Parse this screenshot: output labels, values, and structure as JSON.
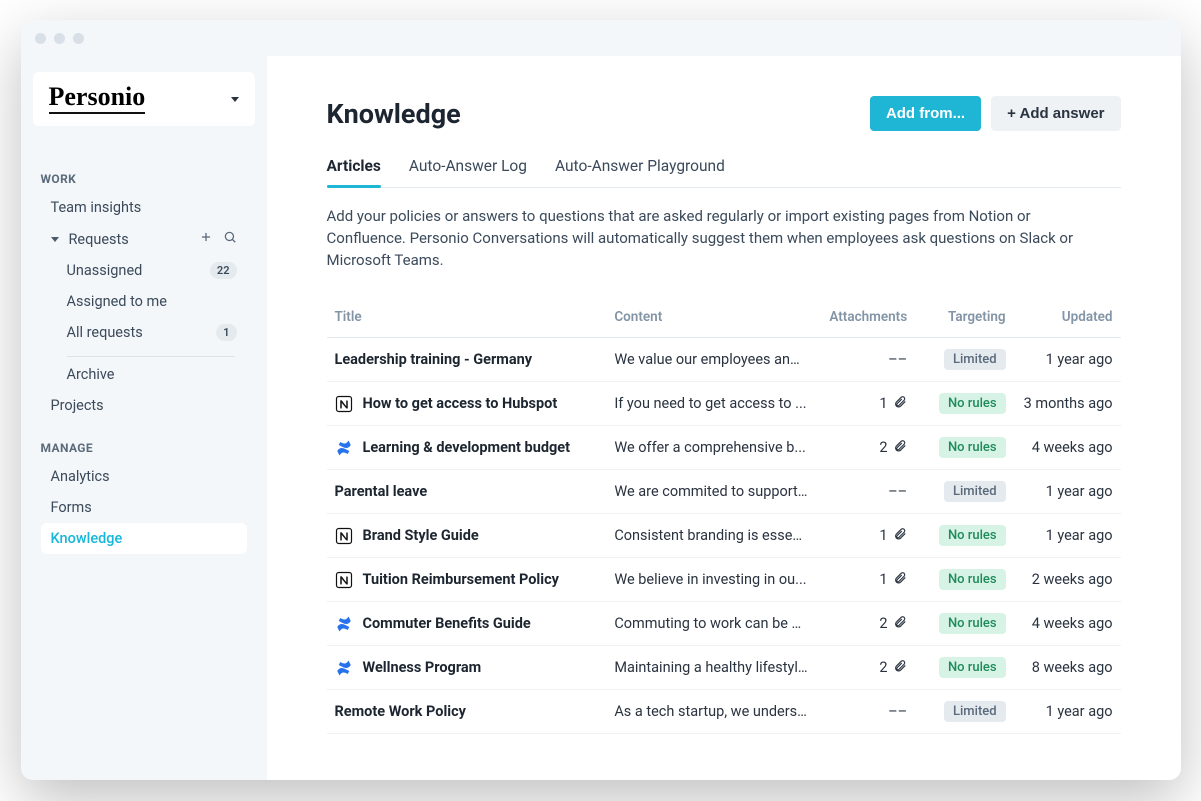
{
  "brand": "Personio",
  "sidebar": {
    "sections": [
      {
        "heading": "WORK",
        "items": [
          {
            "label": "Team insights"
          },
          {
            "label": "Requests",
            "expandable": true,
            "expanded": true,
            "children": [
              {
                "label": "Unassigned",
                "badge": "22"
              },
              {
                "label": "Assigned to me"
              },
              {
                "label": "All requests",
                "badge": "1"
              },
              {
                "divider": true
              },
              {
                "label": "Archive"
              }
            ]
          },
          {
            "label": "Projects"
          }
        ]
      },
      {
        "heading": "MANAGE",
        "items": [
          {
            "label": "Analytics"
          },
          {
            "label": "Forms"
          },
          {
            "label": "Knowledge",
            "active": true
          }
        ]
      }
    ]
  },
  "page": {
    "title": "Knowledge",
    "actions": {
      "add_from": "Add from...",
      "add_answer": "+ Add answer"
    },
    "tabs": [
      {
        "label": "Articles",
        "active": true
      },
      {
        "label": "Auto-Answer Log"
      },
      {
        "label": "Auto-Answer Playground"
      }
    ],
    "description": "Add your policies or answers to questions that are asked regularly or import existing pages from Notion or Confluence. Personio Conversations will automatically suggest them when employees ask questions on Slack or Microsoft Teams."
  },
  "table": {
    "columns": {
      "title": "Title",
      "content": "Content",
      "attachments": "Attachments",
      "targeting": "Targeting",
      "updated": "Updated"
    },
    "rows": [
      {
        "source": "none",
        "title": "Leadership training - Germany",
        "content": "We value our employees and...",
        "attachments": "––",
        "targeting": "Limited",
        "updated": "1 year ago"
      },
      {
        "source": "notion",
        "title": "How to get access to Hubspot",
        "content": "If you need to get access to ...",
        "attachments": "1",
        "targeting": "No rules",
        "updated": "3 months ago"
      },
      {
        "source": "confluence",
        "title": "Learning & development budget",
        "content": "We offer a comprehensive b...",
        "attachments": "2",
        "targeting": "No rules",
        "updated": "4 weeks ago"
      },
      {
        "source": "none",
        "title": "Parental leave",
        "content": "We are commited to support...",
        "attachments": "––",
        "targeting": "Limited",
        "updated": "1 year ago"
      },
      {
        "source": "notion",
        "title": "Brand Style Guide",
        "content": "Consistent branding is essen...",
        "attachments": "1",
        "targeting": "No rules",
        "updated": "1 year ago"
      },
      {
        "source": "notion",
        "title": "Tuition Reimbursement Policy",
        "content": "We believe in investing in ou...",
        "attachments": "1",
        "targeting": "No rules",
        "updated": "2 weeks ago"
      },
      {
        "source": "confluence",
        "title": "Commuter Benefits Guide",
        "content": "Commuting to work can be e...",
        "attachments": "2",
        "targeting": "No rules",
        "updated": "4 weeks ago"
      },
      {
        "source": "confluence",
        "title": "Wellness Program",
        "content": "Maintaining a healthy lifestyl...",
        "attachments": "2",
        "targeting": "No rules",
        "updated": "8 weeks ago"
      },
      {
        "source": "none",
        "title": "Remote Work Policy",
        "content": "As a tech startup, we underst...",
        "attachments": "––",
        "targeting": "Limited",
        "updated": "1 year ago"
      }
    ]
  }
}
